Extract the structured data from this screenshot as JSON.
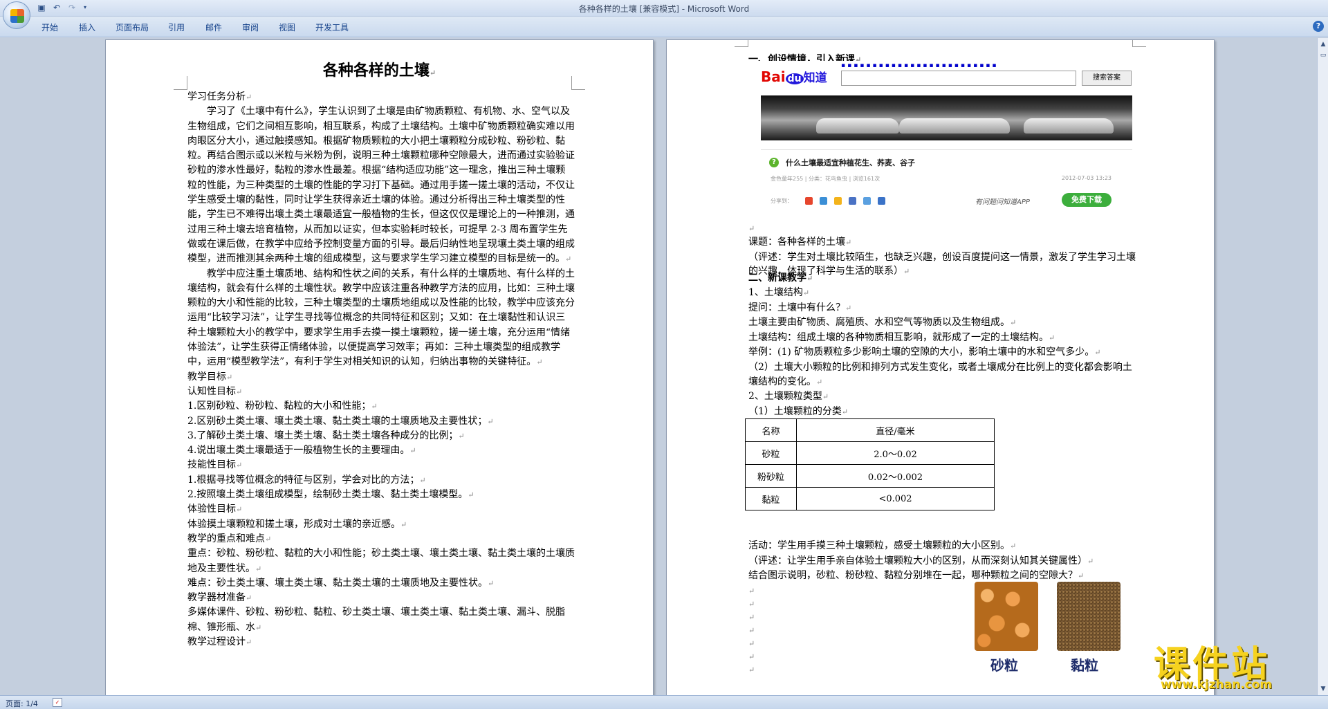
{
  "window": {
    "title": "各种各样的土壤 [兼容模式] - Microsoft Word"
  },
  "qat": {
    "save_icon": "save-icon",
    "undo_icon": "undo-icon",
    "redo_icon": "redo-icon"
  },
  "ribbon": {
    "tabs": [
      "开始",
      "插入",
      "页面布局",
      "引用",
      "邮件",
      "审阅",
      "视图",
      "开发工具"
    ]
  },
  "left_page": {
    "title": "各种各样的土壤",
    "paragraphs": [
      {
        "text": "学习任务分析",
        "indent": false
      },
      {
        "text": "学习了《土壤中有什么》，学生认识到了土壤是由矿物质颗粒、有机物、水、空气以及生物组成，它们之间相互影响，相互联系，构成了土壤结构。土壤中矿物质颗粒确实难以用肉眼区分大小，通过触摸感知。根据矿物质颗粒的大小把土壤颗粒分成砂粒、粉砂粒、黏粒。再结合图示或以米粒与米粉为例，说明三种土壤颗粒哪种空隙最大，进而通过实验验证砂粒的渗水性最好，黏粒的渗水性最差。根据“结构适应功能”这一理念，推出三种土壤颗粒的性能，为三种类型的土壤的性能的学习打下基础。通过用手搓一搓土壤的活动，不仅让学生感受土壤的黏性，同时让学生获得亲近土壤的体验。通过分析得出三种土壤类型的性能，学生已不难得出壤土类土壤最适宜一般植物的生长，但这仅仅是理论上的一种推测，通过用三种土壤去培育植物，从而加以证实，但本实验耗时较长，可提早 2-3 周布置学生先做或在课后做，在教学中应给予控制变量方面的引导。最后归纳性地呈现壤土类土壤的组成模型，进而推测其余两种土壤的组成模型，这与要求学生学习建立模型的目标是统一的。",
        "indent": true
      },
      {
        "text": "教学中应注重土壤质地、结构和性状之间的关系，有什么样的土壤质地、有什么样的土壤结构，就会有什么样的土壤性状。教学中应该注重各种教学方法的应用，比如：三种土壤颗粒的大小和性能的比较，三种土壤类型的土壤质地组成以及性能的比较，教学中应该充分运用“比较学习法”，让学生寻找等位概念的共同特征和区别；又如：在土壤黏性和认识三种土壤颗粒大小的教学中，要求学生用手去摸一摸土壤颗粒，搓一搓土壤，充分运用“情绪体验法”，让学生获得正情绪体验，以便提高学习效率；再如：三种土壤类型的组成教学中，运用“模型教学法”，有利于学生对相关知识的认知，归纳出事物的关键特征。",
        "indent": true
      },
      {
        "text": "教学目标",
        "indent": false
      },
      {
        "text": "认知性目标",
        "indent": false
      },
      {
        "text": "1.区别砂粒、粉砂粒、黏粒的大小和性能；",
        "indent": false
      },
      {
        "text": "2.区别砂土类土壤、壤土类土壤、黏土类土壤的土壤质地及主要性状；",
        "indent": false
      },
      {
        "text": "3.了解砂土类土壤、壤土类土壤、黏土类土壤各种成分的比例；",
        "indent": false
      },
      {
        "text": "4.说出壤土类土壤最适于一般植物生长的主要理由。",
        "indent": false
      },
      {
        "text": "技能性目标",
        "indent": false
      },
      {
        "text": "1.根据寻找等位概念的特征与区别，学会对比的方法；",
        "indent": false
      },
      {
        "text": "2.按照壤土类土壤组成模型，绘制砂土类土壤、黏土类土壤模型。",
        "indent": false
      },
      {
        "text": "体验性目标",
        "indent": false
      },
      {
        "text": "体验摸土壤颗粒和搓土壤，形成对土壤的亲近感。",
        "indent": false
      },
      {
        "text": "教学的重点和难点",
        "indent": false
      },
      {
        "text": "重点：砂粒、粉砂粒、黏粒的大小和性能；砂土类土壤、壤土类土壤、黏土类土壤的土壤质地及主要性状。",
        "indent": false
      },
      {
        "text": "难点：砂土类土壤、壤土类土壤、黏土类土壤的土壤质地及主要性状。",
        "indent": false
      },
      {
        "text": "教学器材准备",
        "indent": false
      },
      {
        "text": "多媒体课件、砂粒、粉砂粒、黏粒、砂土类土壤、壤土类土壤、黏土类土壤、漏斗、脱脂棉、锥形瓶、水",
        "indent": false
      },
      {
        "text": "教学过程设计",
        "indent": false
      }
    ]
  },
  "right_page": {
    "heading1": "一、创设情境，引入新课",
    "baidu": {
      "logo_bai": "Bai",
      "logo_du": "du",
      "logo_zhidao": "知道",
      "search_button": "搜索答案",
      "question_title": "什么土壤最适宜种植花生、荞麦、谷子",
      "question_meta": "金色童年255 | 分类：花鸟鱼虫 | 浏览161次",
      "question_date": "2012-07-03 13:23",
      "share_label": "分享到：",
      "app_text": "有问题问知道APP",
      "download_button": "免费下载"
    },
    "para_after_baidu": [
      "课题：各种各样的土壤",
      "（评述：学生对土壤比较陌生，也缺乏兴趣，创设百度提问这一情景，激发了学生学习土壤的兴趣，体现了科学与生活的联系）"
    ],
    "heading2": "二、新课教学",
    "section_lines": [
      "1、土壤结构",
      "提问：土壤中有什么？",
      "土壤主要由矿物质、腐殖质、水和空气等物质以及生物组成。",
      "土壤结构：组成土壤的各种物质相互影响，就形成了一定的土壤结构。",
      "举例：(1) 矿物质颗粒多少影响土壤的空隙的大小，影响土壤中的水和空气多少。",
      "（2）土壤大小颗粒的比例和排列方式发生变化，或者土壤成分在比例上的变化都会影响土壤结构的变化。",
      "2、土壤颗粒类型",
      "（1）土壤颗粒的分类"
    ],
    "table": {
      "headers": [
        "名称",
        "直径/毫米"
      ],
      "rows": [
        [
          "砂粒",
          "2.0～0.02"
        ],
        [
          "粉砂粒",
          "0.02～0.002"
        ],
        [
          "黏粒",
          "<0.002"
        ]
      ]
    },
    "after_table": [
      "活动：学生用手摸三种土壤颗粒，感受土壤颗粒的大小区别。",
      "（评述：让学生用手亲自体验土壤颗粒大小的区别，从而深刻认知其关键属性）",
      "结合图示说明，砂粒、粉砂粒、黏粒分别堆在一起，哪种颗粒之间的空隙大？"
    ],
    "image_labels": [
      "砂粒",
      "黏粒"
    ]
  },
  "statusbar": {
    "pages": "页面: 1/4"
  },
  "watermark": {
    "main": "课件站",
    "url": "www.kjzhan.com"
  },
  "marks": {
    "para": "↵"
  }
}
